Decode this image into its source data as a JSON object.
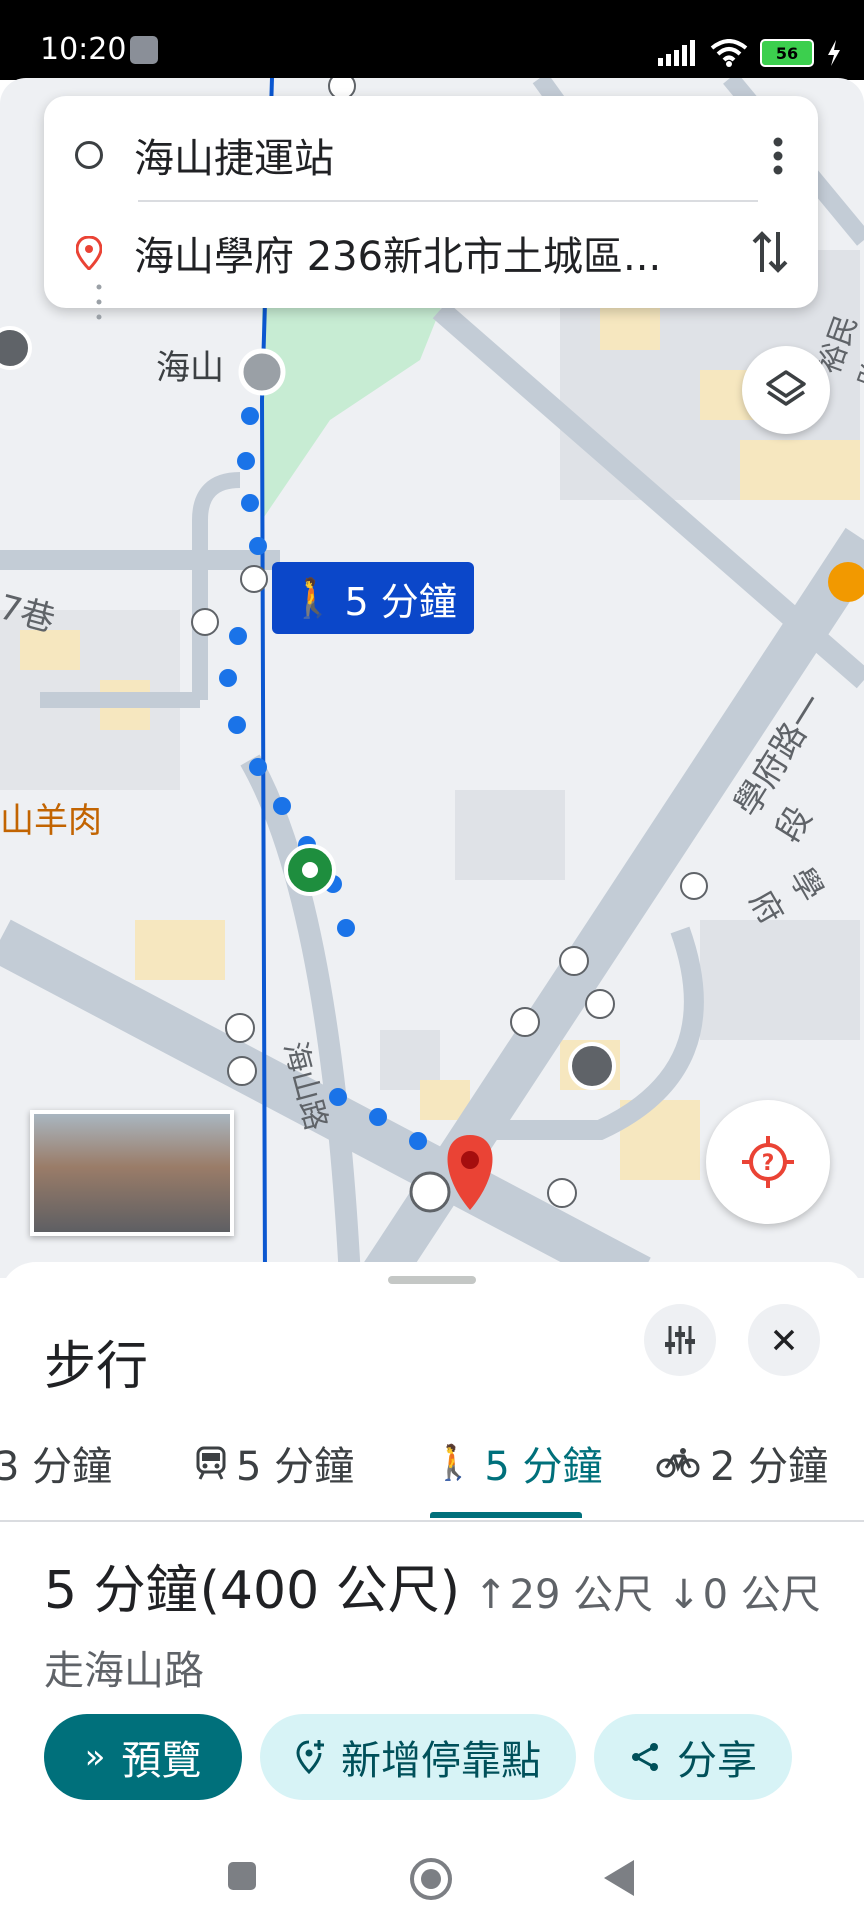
{
  "status_bar": {
    "time": "10:20",
    "battery": "56"
  },
  "search": {
    "origin": "海山捷運站",
    "destination": "海山學府 236新北市土城區..."
  },
  "map": {
    "route_label": "5 分鐘",
    "station_label": "海山",
    "labels": {
      "lane": "7巷",
      "restaurant": "山羊肉",
      "road_hs": "海山路",
      "road_xf": "學府路一段",
      "road_xf_short": "學府",
      "road_yu": "裕民路"
    }
  },
  "panel": {
    "title": "步行",
    "tabs": [
      {
        "label": "3 分鐘",
        "icon": "car-icon"
      },
      {
        "label": "5 分鐘",
        "icon": "transit-icon"
      },
      {
        "label": "5 分鐘",
        "icon": "walk-icon",
        "active": true
      },
      {
        "label": "2 分鐘",
        "icon": "bike-icon"
      }
    ],
    "summary": {
      "duration": "5 分鐘",
      "distance": "(400 公尺)",
      "ascent": "29 公尺",
      "descent": "0 公尺"
    },
    "via": "走海山路",
    "actions": {
      "preview": "預覽",
      "add_stop": "新增停靠點",
      "share": "分享"
    }
  },
  "colors": {
    "accent": "#00707b",
    "route_blue": "#1a73e8",
    "pin_red": "#ea4335",
    "metro_line": "#0b57d0"
  }
}
